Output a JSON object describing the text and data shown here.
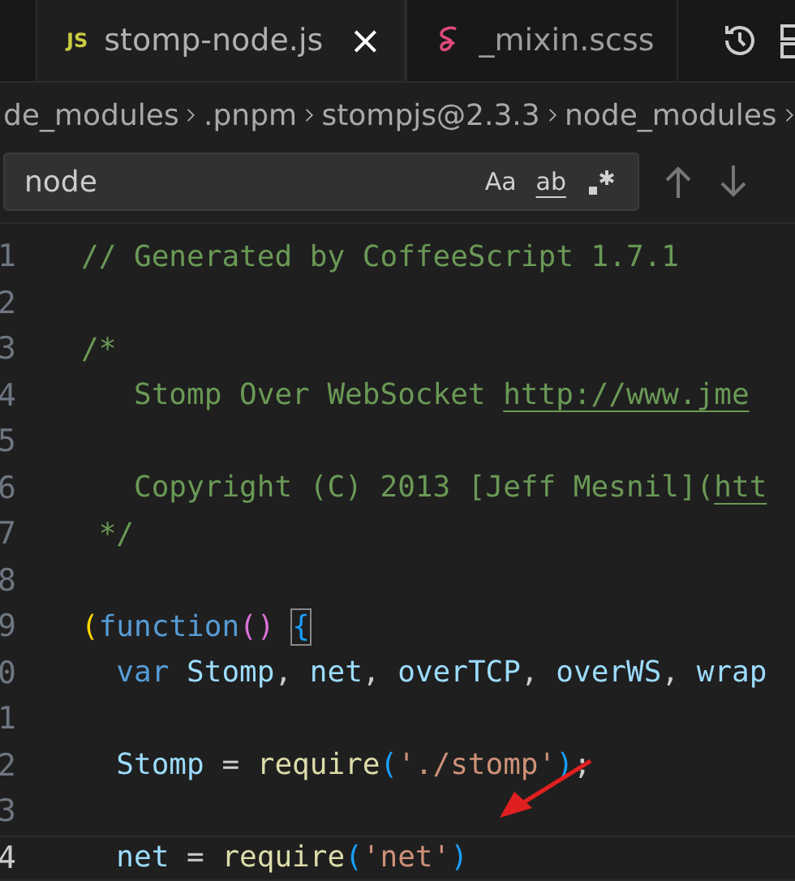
{
  "tabs": [
    {
      "label": "stomp-node.js",
      "selected": true,
      "kind": "js",
      "icon": "JS",
      "close": "×"
    },
    {
      "label": "_mixin.scss",
      "selected": false,
      "kind": "scss"
    }
  ],
  "breadcrumb": [
    "de_modules",
    ".pnpm",
    "stompjs@2.3.3",
    "node_modules"
  ],
  "find": {
    "value": "node",
    "toggles": [
      {
        "label": "Aa",
        "kind": "case",
        "on": false
      },
      {
        "label": "ab",
        "kind": "word",
        "on": false
      },
      {
        "kind": "regex",
        "on": false
      }
    ]
  },
  "editor": {
    "lines": [
      {
        "number": "1",
        "current": false,
        "tokens": [
          {
            "text": "// Generated by CoffeeScript 1.7.1",
            "kind": "comment"
          }
        ]
      },
      {
        "number": "2",
        "current": false
      },
      {
        "number": "3",
        "current": false,
        "tokens": [
          {
            "text": "/*",
            "kind": "comment"
          }
        ]
      },
      {
        "number": "4",
        "current": false,
        "tokens": [
          {
            "text": "   Stomp Over WebSocket ",
            "kind": "comment"
          },
          {
            "text": "http://www.jme",
            "kind": "link"
          }
        ]
      },
      {
        "number": "5",
        "current": false
      },
      {
        "number": "6",
        "current": false,
        "tokens": [
          {
            "text": "   Copyright (C) 2013 [Jeff Mesnil](",
            "kind": "comment"
          },
          {
            "text": "htt",
            "kind": "link"
          }
        ]
      },
      {
        "number": "7",
        "current": false,
        "tokens": [
          {
            "text": " */",
            "kind": "comment"
          }
        ]
      },
      {
        "number": "8",
        "current": false
      },
      {
        "number": "9",
        "current": false,
        "tokens": [
          {
            "text": "(",
            "kind": "brace1"
          },
          {
            "text": "function",
            "kind": "keyword"
          },
          {
            "text": "() ",
            "kind": "brace2"
          },
          {
            "text": "{",
            "kind": "brace3",
            "boxed": true
          }
        ]
      },
      {
        "number": "0",
        "current": false,
        "tokens": [
          {
            "text": "  var",
            "kind": "keyword"
          },
          {
            "text": " Stomp",
            "kind": "variable"
          },
          {
            "text": ", ",
            "kind": "punct"
          },
          {
            "text": "net",
            "kind": "variable"
          },
          {
            "text": ", ",
            "kind": "punct"
          },
          {
            "text": "overTCP",
            "kind": "variable"
          },
          {
            "text": ", ",
            "kind": "punct"
          },
          {
            "text": "overWS",
            "kind": "variable"
          },
          {
            "text": ", ",
            "kind": "punct"
          },
          {
            "text": "wrap",
            "kind": "variable"
          }
        ]
      },
      {
        "number": "1",
        "current": false
      },
      {
        "number": "2",
        "current": false,
        "tokens": [
          {
            "text": "  Stomp",
            "kind": "variable"
          },
          {
            "text": " = ",
            "kind": "punct"
          },
          {
            "text": "require",
            "kind": "function"
          },
          {
            "text": "(",
            "kind": "brace3"
          },
          {
            "text": "'./stomp'",
            "kind": "string"
          },
          {
            "text": ")",
            "kind": "brace3"
          },
          {
            "text": ";",
            "kind": "punct"
          }
        ]
      },
      {
        "number": "3",
        "current": false
      },
      {
        "number": "4",
        "current": true,
        "tokens": [
          {
            "text": "  net",
            "kind": "variable"
          },
          {
            "text": " = ",
            "kind": "punct"
          },
          {
            "text": "require",
            "kind": "function"
          },
          {
            "text": "(",
            "kind": "brace3"
          },
          {
            "text": "'net'",
            "kind": "string"
          },
          {
            "text": ")",
            "kind": "brace3"
          }
        ]
      }
    ]
  },
  "annotation": {
    "kind": "arrow",
    "color": "#e02020"
  }
}
